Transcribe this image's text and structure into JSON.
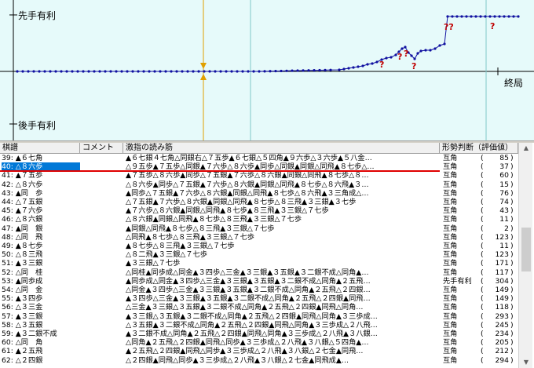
{
  "graph": {
    "top_label": "先手有利",
    "bottom_label": "後手有利",
    "end_label": "終局",
    "marks": [
      "?",
      "?",
      "?",
      "?",
      "??",
      "?"
    ],
    "colors": {
      "background": "#e6fafa",
      "line": "#1010a0",
      "cursor": "#e0a000",
      "marker": "#80c8c8",
      "mark": "#c00000"
    }
  },
  "list": {
    "headers": [
      "棋譜",
      "コメント",
      "激指の読み筋",
      "形勢判断（評価値）"
    ],
    "selected_index": 1,
    "rows": [
      {
        "move": "39: ▲６七角",
        "comment": "",
        "line": "▲６七銀４七角△同銀右△７五歩▲６七銀△５四角▲９六歩△３六歩▲５八金…",
        "judge": "互角",
        "score": "85"
      },
      {
        "move": "40: △８六歩",
        "comment": "",
        "line": "△９五歩▲７五歩△同銀▲７六歩△８六歩▲同歩△同銀▲同銀△同飛▲８七歩△…",
        "judge": "互角",
        "score": "37"
      },
      {
        "move": "41: ▲７五歩",
        "comment": "",
        "line": "▲７五歩△８六歩▲同歩△７五銀▲７六歩△８六銀▲同銀△同飛▲８七歩△８…",
        "judge": "互角",
        "score": "60"
      },
      {
        "move": "42: △８六歩",
        "comment": "",
        "line": "△８六歩▲同歩△７五銀▲７六歩△８六銀▲同銀△同飛▲８七歩△８六飛▲３…",
        "judge": "互角",
        "score": "15"
      },
      {
        "move": "43: ▲同　歩",
        "comment": "",
        "line": "▲同歩△７五銀▲７六歩△８六銀▲同銀△同飛▲８七歩△８六飛▲３三角成△…",
        "judge": "互角",
        "score": "76"
      },
      {
        "move": "44: △７五銀",
        "comment": "",
        "line": "△７五銀▲７六歩△８六銀▲同銀△同飛▲８七歩△８三飛▲３三銀▲３七歩",
        "judge": "互角",
        "score": "74"
      },
      {
        "move": "45: ▲７六歩",
        "comment": "",
        "line": "▲７六歩△８六銀▲同銀△同飛▲８七歩▲８三飛▲３三銀△７七歩",
        "judge": "互角",
        "score": "43"
      },
      {
        "move": "46: △８六銀",
        "comment": "",
        "line": "△８六銀▲同銀△同飛▲８七歩△８三飛▲３三銀△７七歩",
        "judge": "互角",
        "score": "11"
      },
      {
        "move": "47: ▲同　銀",
        "comment": "",
        "line": "▲同銀△同飛▲８七歩△８三飛▲３三銀△７七歩",
        "judge": "互角",
        "score": "2"
      },
      {
        "move": "48: △同　飛",
        "comment": "",
        "line": "△同飛▲８七歩△８三飛▲３三銀△７七歩",
        "judge": "互角",
        "score": "123"
      },
      {
        "move": "49: ▲８七歩",
        "comment": "",
        "line": "▲８七歩△８三飛▲３三銀△７七歩",
        "judge": "互角",
        "score": "11"
      },
      {
        "move": "50: △８三飛",
        "comment": "",
        "line": "△８二飛▲３三銀△７七歩",
        "judge": "互角",
        "score": "123"
      },
      {
        "move": "51: ▲３三銀",
        "comment": "",
        "line": "▲３三銀△７七歩",
        "judge": "互角",
        "score": "171"
      },
      {
        "move": "52: △同　桂",
        "comment": "",
        "line": "△同桂▲同歩成△同金▲３四歩△三金▲３三銀▲３五銀▲３二銀不成△同角▲…",
        "judge": "互角",
        "score": "117"
      },
      {
        "move": "53: ▲同歩成",
        "comment": "",
        "line": "▲同歩成△同金▲３四歩△三金▲３三銀▲３五銀▲３二銀不成△同角▲２五飛…",
        "judge": "先手有利",
        "score": "304"
      },
      {
        "move": "54: △同　金",
        "comment": "",
        "line": "△同金▲３四歩△三金▲３三銀▲３五銀▲３二銀不成△同角▲２五飛△２四銀…",
        "judge": "互角",
        "score": "149"
      },
      {
        "move": "55: ▲３四歩",
        "comment": "",
        "line": "▲３四歩△三金▲３三銀▲３五銀▲３二銀不成△同角▲２五飛△２四銀▲同飛…",
        "judge": "互角",
        "score": "149"
      },
      {
        "move": "56: △３三金",
        "comment": "",
        "line": "△三金▲３三銀△３五銀▲３二銀不成△同角▲２五飛△２四銀▲同飛△同角…",
        "judge": "互角",
        "score": "118"
      },
      {
        "move": "57: ▲３三銀",
        "comment": "",
        "line": "▲３三銀△３五銀▲３二銀不成△同角▲２五飛△２四銀▲同飛△同角▲３三歩成…",
        "judge": "互角",
        "score": "293"
      },
      {
        "move": "58: △３五銀",
        "comment": "",
        "line": "△３五銀▲３二銀不成△同角▲２五飛△２四銀▲同飛△同角▲３三歩成△２八飛…",
        "judge": "互角",
        "score": "245"
      },
      {
        "move": "59: ▲３二銀不成",
        "comment": "",
        "line": "▲３二銀不成△同角▲２五飛△２四銀▲同飛△同角▲３三歩成△２八飛▲３八銀…",
        "judge": "互角",
        "score": "234"
      },
      {
        "move": "60: △同　角",
        "comment": "",
        "line": "△同角▲２五飛△２四銀▲同飛△同歩▲３三歩成△２八飛▲３八銀△５四角▲…",
        "judge": "互角",
        "score": "205"
      },
      {
        "move": "61: ▲２五飛",
        "comment": "",
        "line": "▲２五飛△２四銀▲同飛△同歩▲３三歩成△２八飛▲３八銀△２七金▲同飛…",
        "judge": "互角",
        "score": "212"
      },
      {
        "move": "62: △２四銀",
        "comment": "",
        "line": "△２四銀▲同飛△同歩▲３三歩成△２八飛▲３八銀△２七金▲同飛成▲…",
        "judge": "互角",
        "score": "294"
      }
    ]
  }
}
